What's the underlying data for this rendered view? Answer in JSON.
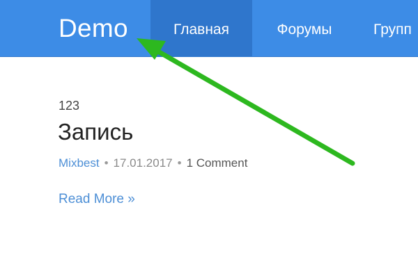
{
  "header": {
    "site_title": "Demo",
    "nav": [
      {
        "label": "Главная",
        "active": true
      },
      {
        "label": "Форумы",
        "active": false
      },
      {
        "label": "Групп",
        "active": false
      }
    ],
    "background_color": "#3d8ce6",
    "active_tab_color": "#2f76cc"
  },
  "post": {
    "category": "123",
    "title": "Запись",
    "author": "Mixbest",
    "separator": "•",
    "date": "17.01.2017",
    "comments": "1 Comment",
    "read_more": "Read More »"
  },
  "annotation": {
    "icon": "arrow-icon",
    "color": "#2db81f"
  }
}
